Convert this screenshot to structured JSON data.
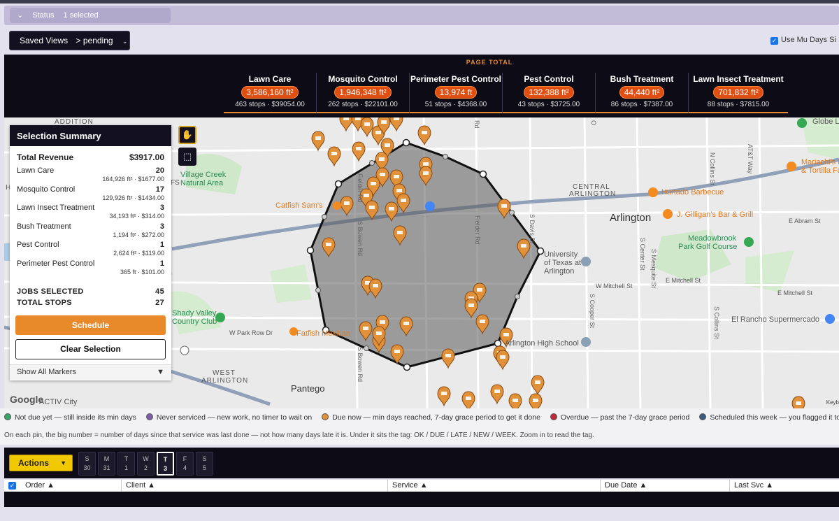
{
  "status_bar": {
    "chevron": "⌄",
    "label": "Status",
    "value": "1 selected"
  },
  "saved_views": {
    "label": "Saved Views",
    "value": "> pending",
    "chevron": "⌄"
  },
  "multiday": {
    "checked": true,
    "label": "Use Mu Days Si"
  },
  "page_total": {
    "title": "PAGE TOTAL",
    "cards": [
      {
        "service": "Lawn Care",
        "sqft": "3,586,160 ft²",
        "meta": "463 stops · $39054.00"
      },
      {
        "service": "Mosquito Control",
        "sqft": "1,946,348 ft²",
        "meta": "262 stops · $22101.00"
      },
      {
        "service": "Perimeter Pest Control",
        "sqft": "13,974 ft",
        "meta": "51 stops · $4368.00"
      },
      {
        "service": "Pest Control",
        "sqft": "132,388 ft²",
        "meta": "43 stops · $3725.00"
      },
      {
        "service": "Bush Treatment",
        "sqft": "44,440 ft²",
        "meta": "86 stops · $7387.00"
      },
      {
        "service": "Lawn Insect Treatment",
        "sqft": "701,832 ft²",
        "meta": "88 stops · $7815.00"
      }
    ]
  },
  "selection": {
    "title": "Selection Summary",
    "total_label": "Total Revenue",
    "total_value": "$3917.00",
    "services": [
      {
        "name": "Lawn Care",
        "count": "20",
        "sub": "164,926 ft² · $1677.00"
      },
      {
        "name": "Mosquito Control",
        "count": "17",
        "sub": "129,926 ft² · $1434.00"
      },
      {
        "name": "Lawn Insect Treatment",
        "count": "3",
        "sub": "34,193 ft² · $314.00"
      },
      {
        "name": "Bush Treatment",
        "count": "3",
        "sub": "1,194 ft² · $272.00"
      },
      {
        "name": "Pest Control",
        "count": "1",
        "sub": "2,624 ft² · $119.00"
      },
      {
        "name": "Perimeter Pest Control",
        "count": "1",
        "sub": "365 ft · $101.00"
      }
    ],
    "jobs_label": "JOBS SELECTED",
    "jobs_value": "45",
    "stops_label": "TOTAL STOPS",
    "stops_value": "27",
    "schedule_label": "Schedule",
    "clear_label": "Clear Selection",
    "show_all_label": "Show All Markers",
    "show_all_chevron": "▼"
  },
  "map": {
    "labels": {
      "addition": "ADDITION",
      "village_creek": "Village Creek",
      "natural_area": "Natural Area",
      "fs": "FS",
      "h": "H",
      "catfish": "Catfish Sam's",
      "central": "CENTRAL",
      "arlington_district": "ARLINGTON",
      "arlington": "Arlington",
      "hurtado": "Hurtado Barbecue",
      "gilligan": "J. Gilligan's Bar & Grill",
      "meadowbrook": "Meadowbrook",
      "golf": "Park Golf Course",
      "uta1": "University",
      "uta2": "of Texas at",
      "uta3": "Arlington",
      "abram": "E Abram St",
      "mitchell_w": "W Mitchell St",
      "mitchell_e": "E Mitchell St",
      "mitchell_e2": "E Mitchell St",
      "shady1": "Shady Valley",
      "shady2": "Country Club",
      "park_row": "W Park Row Dr",
      "fatfish": "Fatfish Mexican",
      "arlington_hs": "Arlington High School",
      "el_rancho": "El Rancho Supermercado",
      "west": "WEST",
      "west_arlington": "ARLINGTON",
      "pantego": "Pantego",
      "activ": "ACTIV City",
      "globe": "Globe Li",
      "mariachi1": "Mariachi's Bar",
      "mariachi2": "& Tortilla Fa",
      "fielder": "Fielder Rd",
      "davis": "S Davis Dr",
      "cooper": "S Cooper St",
      "center": "S Center St",
      "mesquite": "S Mesquite St",
      "collins": "S Collins St",
      "n_collins": "N Collins St",
      "att": "AT&T Way",
      "bowen": "S Bowen Rd",
      "rd": "Rd",
      "o": "O"
    },
    "google_label": "Google",
    "keyboard_label": "Keyb"
  },
  "tools": {
    "hand_icon": "✋",
    "rect_icon": "⬚"
  },
  "legend": {
    "items": [
      {
        "color": "#3aa36b",
        "text": "Not due yet — still inside its min days"
      },
      {
        "color": "#7b5ea7",
        "text": "Never serviced — new work, no timer to wait on"
      },
      {
        "color": "#e0913a",
        "text": "Due now — min days reached, 7-day grace period to get it done"
      },
      {
        "color": "#c0283c",
        "text": "Overdue — past the 7-day grace period"
      },
      {
        "color": "#3d5a80",
        "text": "Scheduled this week — you flagged it to be"
      }
    ],
    "note": "On each pin, the big number = number of days since that service was last done — not how many days late it is. Under it sits the tag: OK / DUE / LATE / NEW / WEEK. Zoom in to read the tag."
  },
  "toolbar": {
    "actions_label": "Actions",
    "actions_arrow": "▼",
    "days": [
      {
        "d": "S",
        "n": "30",
        "active": false
      },
      {
        "d": "M",
        "n": "31",
        "active": false
      },
      {
        "d": "T",
        "n": "1",
        "active": false
      },
      {
        "d": "W",
        "n": "2",
        "active": false
      },
      {
        "d": "T",
        "n": "3",
        "active": true
      },
      {
        "d": "F",
        "n": "4",
        "active": false
      },
      {
        "d": "S",
        "n": "5",
        "active": false
      }
    ]
  },
  "table": {
    "checkbox": "✓",
    "columns": [
      "Order ▲",
      "Client ▲",
      "Service ▲",
      "Due Date ▲",
      "Last Svc ▲"
    ]
  }
}
